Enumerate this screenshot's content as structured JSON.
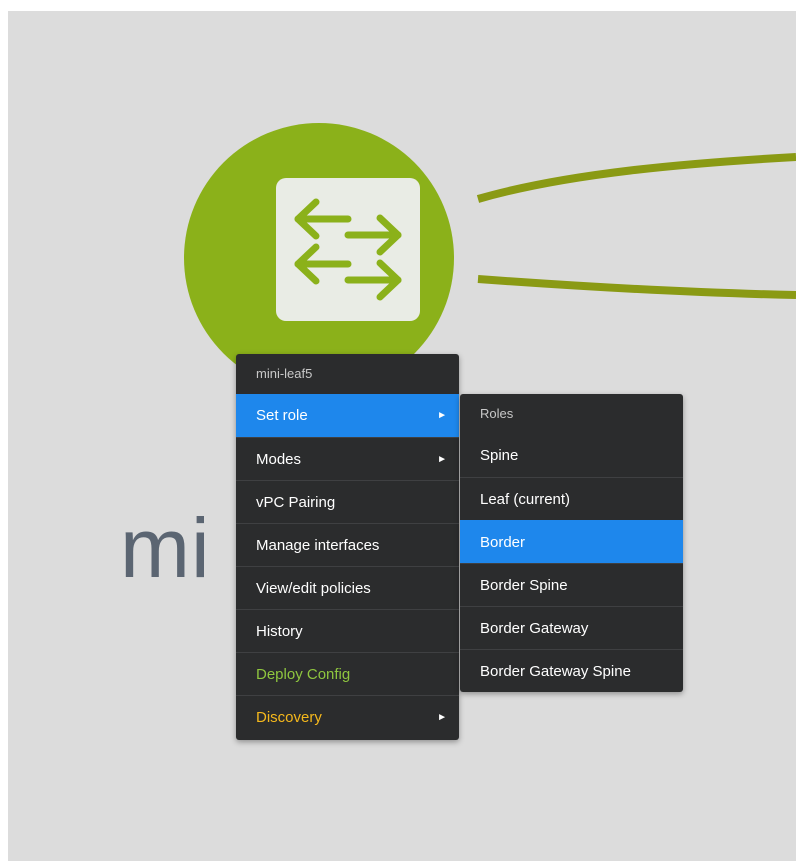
{
  "topology": {
    "node_label": "mi",
    "node_color": "#8bb11a",
    "link_color": "#8a9a14",
    "node_icon": "switch-arrows-icon"
  },
  "context_menu": {
    "title": "mini-leaf5",
    "items": [
      {
        "label": "Set role",
        "has_submenu": true,
        "selected": true
      },
      {
        "label": "Modes",
        "has_submenu": true
      },
      {
        "label": "vPC Pairing"
      },
      {
        "label": "Manage interfaces"
      },
      {
        "label": "View/edit policies"
      },
      {
        "label": "History"
      },
      {
        "label": "Deploy Config",
        "color": "#8fc63f"
      },
      {
        "label": "Discovery",
        "has_submenu": true,
        "color": "#f5b81c"
      }
    ],
    "submenu_chevron": "►",
    "selected_color": "#1e87ec"
  },
  "roles_submenu": {
    "title": "Roles",
    "items": [
      {
        "label": "Spine"
      },
      {
        "label": "Leaf (current)"
      },
      {
        "label": "Border",
        "selected": true
      },
      {
        "label": "Border Spine"
      },
      {
        "label": "Border Gateway"
      },
      {
        "label": "Border Gateway Spine"
      }
    ]
  }
}
